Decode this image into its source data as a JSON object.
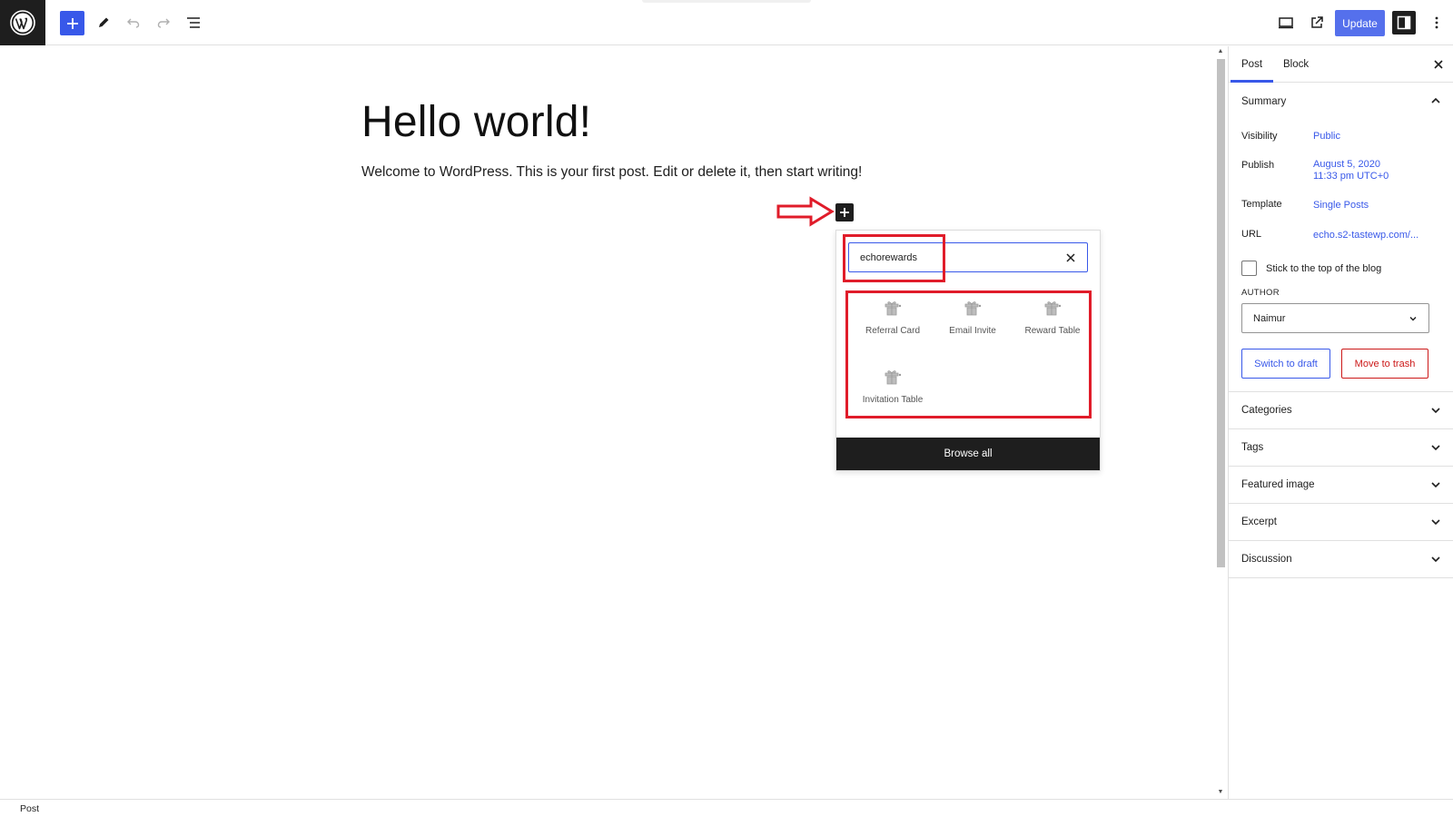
{
  "toolbar": {
    "add_label": "+",
    "update_label": "Update"
  },
  "post": {
    "title": "Hello world!",
    "paragraph": "Welcome to WordPress. This is your first post. Edit or delete it, then start writing!"
  },
  "inserter": {
    "search_value": "echorewards",
    "blocks": [
      {
        "label": "Referral Card"
      },
      {
        "label": "Email Invite"
      },
      {
        "label": "Reward Table"
      },
      {
        "label": "Invitation Table"
      }
    ],
    "browse_all_label": "Browse all"
  },
  "sidebar": {
    "tabs": [
      {
        "label": "Post"
      },
      {
        "label": "Block"
      }
    ],
    "active_tab": "Post",
    "summary": {
      "title": "Summary",
      "visibility_label": "Visibility",
      "visibility_value": "Public",
      "publish_label": "Publish",
      "publish_date": "August 5, 2020",
      "publish_time": "11:33 pm UTC+0",
      "template_label": "Template",
      "template_value": "Single Posts",
      "url_label": "URL",
      "url_value": "echo.s2-tastewp.com/...",
      "sticky_label": "Stick to the top of the blog",
      "author_label": "AUTHOR",
      "author_value": "Naimur",
      "switch_draft_label": "Switch to draft",
      "move_trash_label": "Move to trash"
    },
    "panels": [
      {
        "label": "Categories"
      },
      {
        "label": "Tags"
      },
      {
        "label": "Featured image"
      },
      {
        "label": "Excerpt"
      },
      {
        "label": "Discussion"
      }
    ]
  },
  "footer": {
    "breadcrumb": "Post"
  },
  "colors": {
    "accent": "#3858e9",
    "annotation_red": "#e01c2a",
    "dark": "#1e1e1e",
    "trash_red": "#cc1818"
  }
}
